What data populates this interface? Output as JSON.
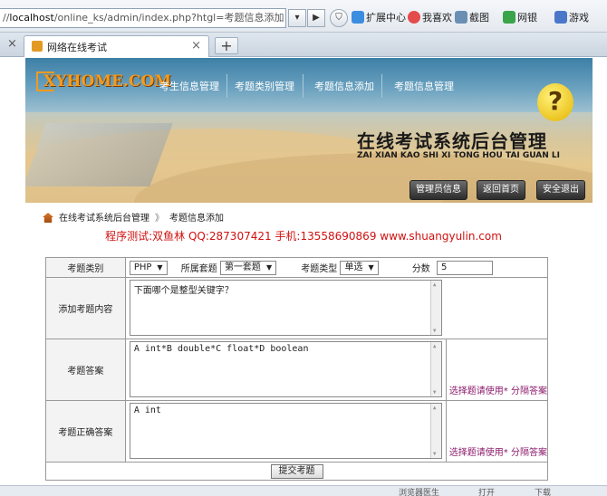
{
  "browser": {
    "url_host": "localhost",
    "url_rest": "/online_ks/admin/index.php?htgl=考题信息添加",
    "url_prefix": "//",
    "go_glyph": "▶",
    "dropdown_glyph": "▾",
    "toolbar": [
      {
        "label": "扩展中心",
        "color": "#3b8de0"
      },
      {
        "label": "我喜欢",
        "color": "#e44c4c"
      },
      {
        "label": "截图",
        "color": "#6a8fb3"
      },
      {
        "label": "网银",
        "color": "#3aa44a"
      },
      {
        "label": "游戏",
        "color": "#4a78c9"
      }
    ],
    "tab_title": "网络在线考试",
    "tab_close": "×",
    "new_tab": "+"
  },
  "header": {
    "logo_text": "XYHOME.COM",
    "nav": [
      "考生信息管理",
      "考题类别管理",
      "考题信息添加",
      "考题信息管理"
    ],
    "system_title": "在线考试系统后台管理",
    "system_pinyin": "ZAI XIAN KAO SHI XI TONG HOU TAI GUAN LI",
    "qmark": "?",
    "buttons": [
      "管理员信息",
      "返回首页",
      "安全退出"
    ]
  },
  "breadcrumb": {
    "root": "在线考试系统后台管理",
    "separator": "》",
    "current": "考题信息添加"
  },
  "tester_info": "程序测试:双鱼林 QQ:287307421 手机:13558690869 www.shuangyulin.com",
  "form": {
    "category_label": "考题类别",
    "category_value": "PHP",
    "set_label": "所属套题",
    "set_value": "第一套题",
    "type_label": "考题类型",
    "type_value": "单选",
    "score_label": "分数",
    "score_value": "5",
    "content_label": "添加考题内容",
    "content_value": "下面哪个是整型关键字？",
    "answer_label": "考题答案",
    "answer_value": "A int*B double*C float*D boolean",
    "answer_hint": "选择题请使用* 分隔答案",
    "correct_label": "考题正确答案",
    "correct_value": "A int",
    "correct_hint": "选择题请使用* 分隔答案",
    "submit_label": "提交考题"
  },
  "status_bar": [
    "浏览器医生",
    "打开",
    "下载"
  ],
  "colors": {
    "accent_orange": "#f39a1e",
    "tester_red": "#d11010",
    "hint_purple": "#8b1a6b"
  }
}
